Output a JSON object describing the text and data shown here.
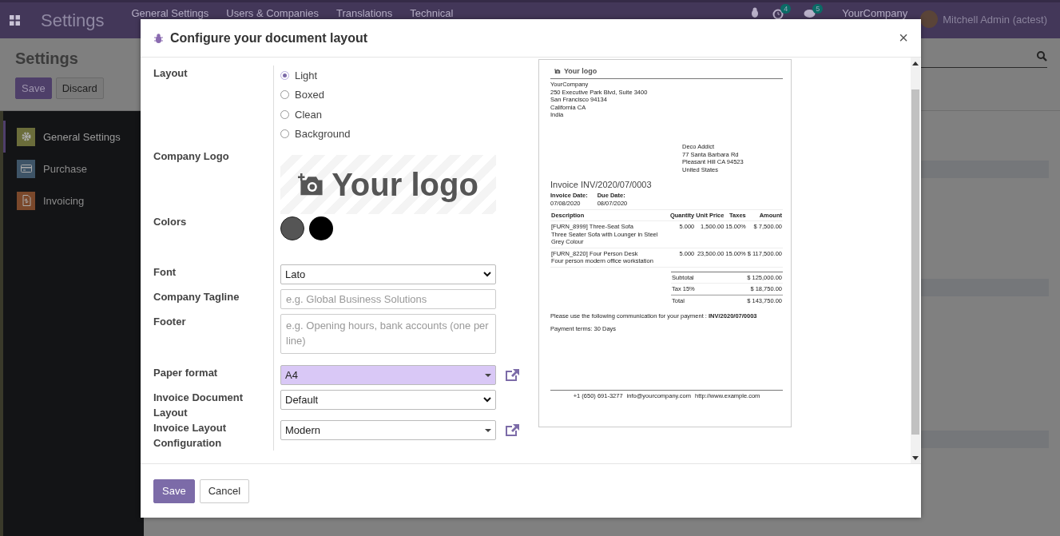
{
  "navbar": {
    "app_title": "Settings",
    "menu": [
      "General Settings",
      "Users & Companies",
      "Translations",
      "Technical"
    ],
    "activity_count": "4",
    "message_count": "5",
    "company": "YourCompany",
    "user": "Mitchell Admin (actest)"
  },
  "control_panel": {
    "breadcrumb": "Settings",
    "buttons": [
      {
        "label": "Save",
        "kind": "primary"
      },
      {
        "label": "Discard",
        "kind": "secondary"
      }
    ]
  },
  "sidebar": {
    "items": [
      {
        "label": "General Settings",
        "selected": true,
        "color": "#6b6d3b"
      },
      {
        "label": "Purchase",
        "selected": false,
        "color": "#3e5467"
      },
      {
        "label": "Invoicing",
        "selected": false,
        "color": "#7a482b"
      }
    ]
  },
  "dialog": {
    "title": "Configure your document layout",
    "close": "×",
    "fields": [
      {
        "label": "Layout",
        "kind": "radio",
        "options": [
          {
            "label": "Light",
            "selected": true
          },
          {
            "label": "Boxed",
            "selected": false
          },
          {
            "label": "Clean",
            "selected": false
          },
          {
            "label": "Background",
            "selected": false
          }
        ]
      },
      {
        "label": "Company Logo",
        "kind": "logo",
        "text": "Your logo"
      },
      {
        "label": "Colors",
        "kind": "colors",
        "colors": [
          {
            "color": "#555555"
          },
          {
            "color": "#000000"
          }
        ]
      },
      {
        "label": "Font",
        "kind": "select",
        "value": "Lato"
      },
      {
        "label": "Company Tagline",
        "kind": "input",
        "placeholder": "e.g. Global Business Solutions"
      },
      {
        "label": "Footer",
        "kind": "textarea",
        "placeholder": "e.g. Opening hours, bank accounts (one per line)"
      },
      {
        "label": "Paper format",
        "kind": "dropdown",
        "value": "A4",
        "highlighted": true,
        "link": true
      },
      {
        "label": "Invoice Document Layout",
        "kind": "select",
        "value": "Default"
      },
      {
        "label": "Invoice Layout Configuration",
        "kind": "dropdown",
        "value": "Modern",
        "highlighted": false,
        "link": true
      }
    ],
    "preview": {
      "logo": "Your logo",
      "company_address": [
        "YourCompany",
        "250 Executive Park Blvd, Suite 3400",
        "San Francisco 94134",
        "California CA",
        "India"
      ],
      "customer_address": [
        "Deco Addict",
        "77 Santa Barbara Rd",
        "Pleasant Hill CA 94523",
        "United States"
      ],
      "title": "Invoice INV/2020/07/0003",
      "dates": [
        {
          "label": "Invoice Date:",
          "value": "07/08/2020"
        },
        {
          "label": "Due Date:",
          "value": "08/07/2020"
        }
      ],
      "columns": [
        "Description",
        "Quantity",
        "Unit Price",
        "Taxes",
        "Amount"
      ],
      "lines": [
        {
          "name": "[FURN_8999] Three-Seat Sofa",
          "description": "Three Seater Sofa with Lounger in Steel Grey Colour",
          "quantity": "5.000",
          "unit_price": "1,500.00",
          "taxes": "15.00%",
          "amount": "$ 7,500.00"
        },
        {
          "name": "[FURN_8220] Four Person Desk",
          "description": "Four person modern office workstation",
          "quantity": "5.000",
          "unit_price": "23,500.00",
          "taxes": "15.00%",
          "amount": "$ 117,500.00"
        }
      ],
      "totals": [
        {
          "label": "Subtotal",
          "value": "$ 125,000.00"
        },
        {
          "label": "Tax 15%",
          "value": "$ 18,750.00"
        },
        {
          "label": "Total",
          "value": "$ 143,750.00"
        }
      ],
      "communication": "Please use the following communication for your payment : **INV/2020/07/0003**",
      "payment_terms": "Payment terms: 30 Days",
      "footer": [
        "+1 (650) 691-3277",
        "info@yourcompany.com",
        "http://www.example.com"
      ]
    },
    "buttons": [
      {
        "label": "Save",
        "kind": "primary"
      },
      {
        "label": "Cancel",
        "kind": "secondary"
      }
    ]
  }
}
